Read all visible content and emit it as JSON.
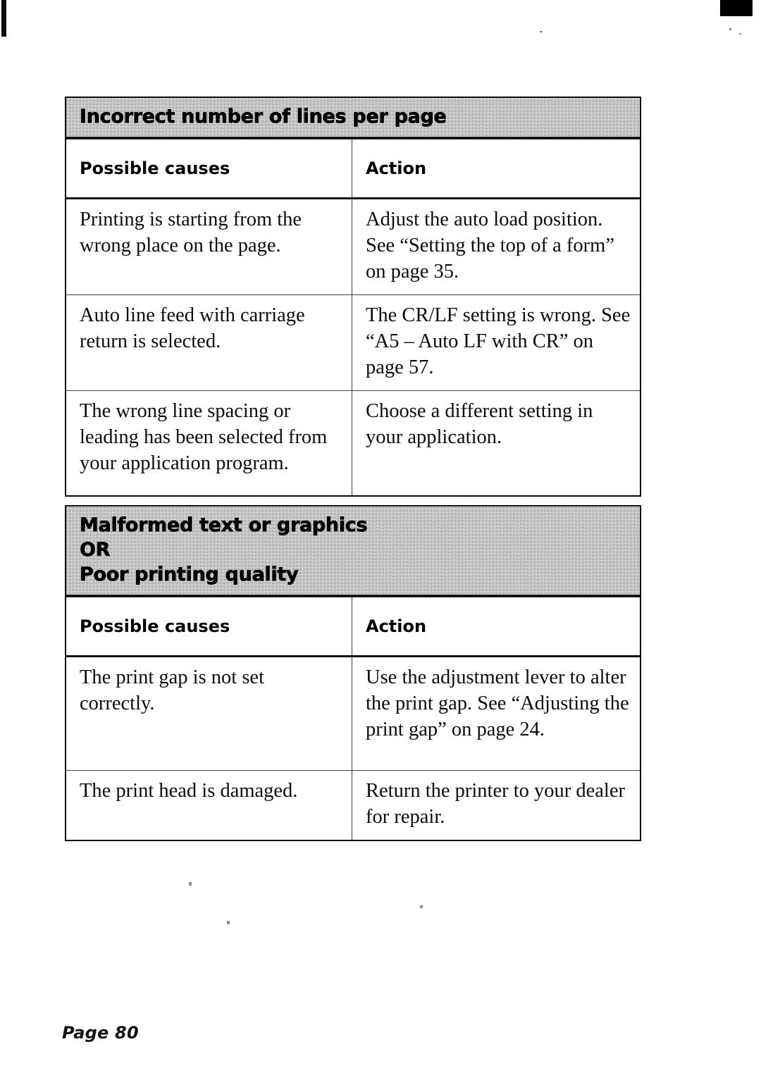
{
  "page": {
    "footer_label": "Page 80"
  },
  "tables": [
    {
      "id": "table-1",
      "banner_lines": [
        "Incorrect number of lines per page"
      ],
      "columns": [
        "Possible causes",
        "Action"
      ],
      "rows": [
        {
          "cause": "Printing is starting from the wrong place on the page.",
          "action": "Adjust the auto load position. See “Setting the top of a form” on page 35."
        },
        {
          "cause": "Auto line feed with carriage return is selected.",
          "action": "The CR/LF setting is wrong. See “A5 – Auto LF with CR” on page 57."
        },
        {
          "cause": "The wrong line spacing or leading has been selected from your application program.",
          "action": "Choose a different setting in your application."
        }
      ]
    },
    {
      "id": "table-2",
      "banner_lines": [
        "Malformed text or graphics",
        "OR",
        "Poor printing quality"
      ],
      "columns": [
        "Possible causes",
        "Action"
      ],
      "rows": [
        {
          "cause": "The print gap is not set correctly.",
          "action": "Use the adjustment lever to alter the print gap. See “Adjusting the print gap” on page 24."
        },
        {
          "cause": "The print head is damaged.",
          "action": "Return the printer to your dealer for repair."
        }
      ]
    }
  ]
}
